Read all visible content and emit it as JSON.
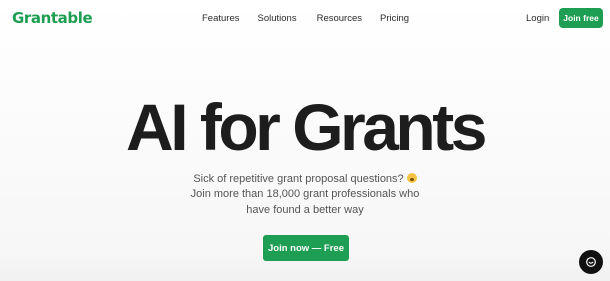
{
  "nav": {
    "logo": "Grantable",
    "links": [
      "Features",
      "Solutions",
      "Resources",
      "Pricing"
    ],
    "login": "Login",
    "join": "Join free"
  },
  "hero": {
    "title": "AI for Grants",
    "line1": "Sick of repetitive grant proposal questions?",
    "line1_emoji": "exhausted-face-emoji",
    "line2": "Join more than 18,000 grant professionals who",
    "line3": "have found a better way",
    "cta": "Join now — Free"
  },
  "widgets": {
    "chat_icon": "chat-bubble-icon"
  },
  "colors": {
    "brand": "#1e9e52",
    "text": "#1d1d1d",
    "chat_button": "#111111"
  }
}
